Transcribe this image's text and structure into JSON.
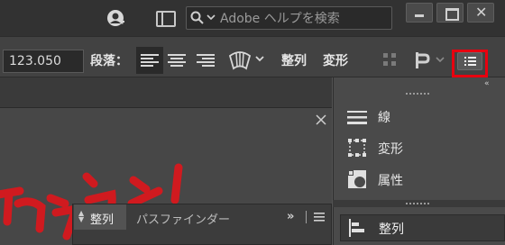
{
  "appbar": {
    "search_placeholder": "Adobe ヘルプを検索",
    "window_controls": [
      "minimize",
      "maximize",
      "close"
    ],
    "close_glyph": "✕"
  },
  "controlbar": {
    "size_value": "123.050",
    "paragraph_label": "段落：",
    "align_link": "整列",
    "transform_link": "変形"
  },
  "float_panel": {
    "tab_align": "整列",
    "tab_pathfinder": "パスファインダー",
    "expand_glyph": "»"
  },
  "dock": {
    "collapse_glyph": "«",
    "items": [
      {
        "label": "線",
        "icon": "stroke-icon"
      },
      {
        "label": "変形",
        "icon": "transform-icon"
      },
      {
        "label": "属性",
        "icon": "attributes-icon"
      }
    ],
    "align_item": {
      "label": "整列",
      "icon": "align-icon"
    }
  },
  "colors": {
    "highlight": "#e8000f",
    "artwork_red": "#d01a1f"
  }
}
